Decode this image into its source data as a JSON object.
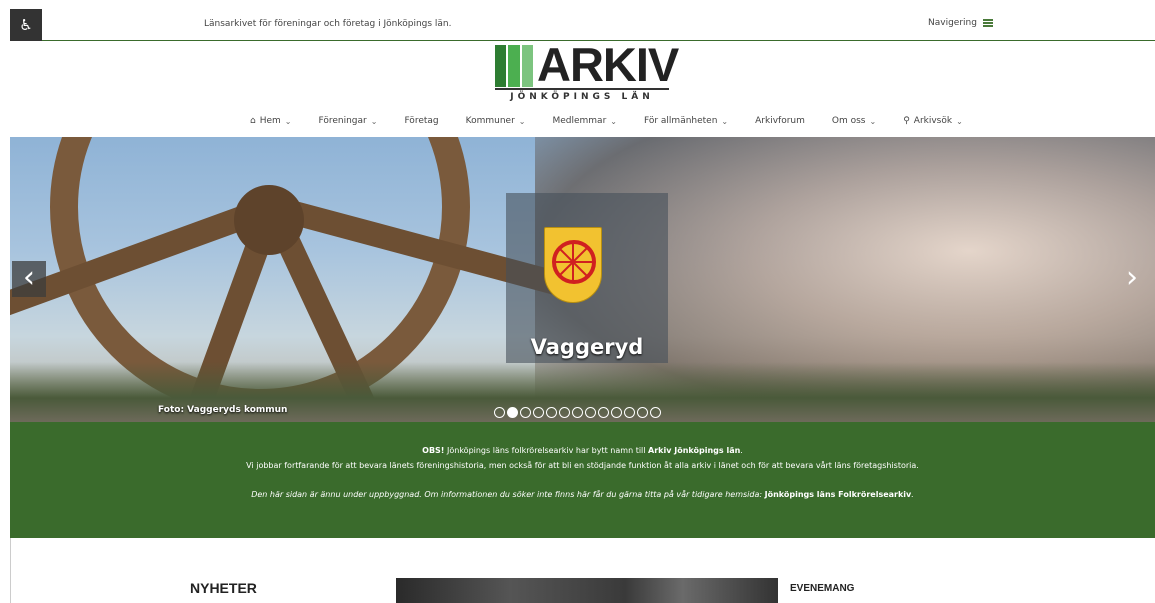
{
  "topbar": {
    "accessibility_glyph": "♿",
    "tagline": "Länsarkivet för föreningar och företag i Jönköpings län.",
    "nav_toggle_label": "Navigering"
  },
  "logo": {
    "word": "ARKIV",
    "subtitle": "JÖNKÖPINGS LÄN",
    "bar_colors": [
      "#2e7d32",
      "#4caf50",
      "#7cc47f"
    ]
  },
  "nav": {
    "items": [
      {
        "label": "Hem",
        "icon": "home-icon",
        "dropdown": true
      },
      {
        "label": "Föreningar",
        "dropdown": true
      },
      {
        "label": "Företag",
        "dropdown": false
      },
      {
        "label": "Kommuner",
        "dropdown": true
      },
      {
        "label": "Medlemmar",
        "dropdown": true
      },
      {
        "label": "För allmänheten",
        "dropdown": true
      },
      {
        "label": "Arkivforum",
        "dropdown": false
      },
      {
        "label": "Om oss",
        "dropdown": true
      },
      {
        "label": "Arkivsök",
        "icon": "search-icon",
        "dropdown": true
      }
    ]
  },
  "hero": {
    "municipality": "Vaggeryd",
    "photo_credit": "Foto: Vaggeryds kommun",
    "prev_glyph": "‹",
    "next_glyph": "›",
    "slide_count": 13,
    "active_slide": 2
  },
  "notice": {
    "line1_obs": "OBS!",
    "line1_text": " Jönköpings läns folkrörelsearkiv har bytt namn till ",
    "line1_name": "Arkiv Jönköpings län",
    "line1_end": ".",
    "line2": "Vi jobbar fortfarande för att bevara länets föreningshistoria, men också för att bli en stödjande funktion åt alla arkiv i länet och för att bevara vårt läns företagshistoria.",
    "line3_text": "Den här sidan är ännu under uppbyggnad. Om informationen du söker inte finns här får du gärna titta på vår tidigare hemsida: ",
    "line3_link": "Jönköpings läns Folkrörelsearkiv",
    "line3_end": "."
  },
  "sections": {
    "news_heading": "NYHETER",
    "events_heading": "EVENEMANG"
  },
  "colors": {
    "brand_green": "#3a6b2c",
    "shield_yellow": "#f2c230",
    "wheel_red": "#d02020"
  }
}
